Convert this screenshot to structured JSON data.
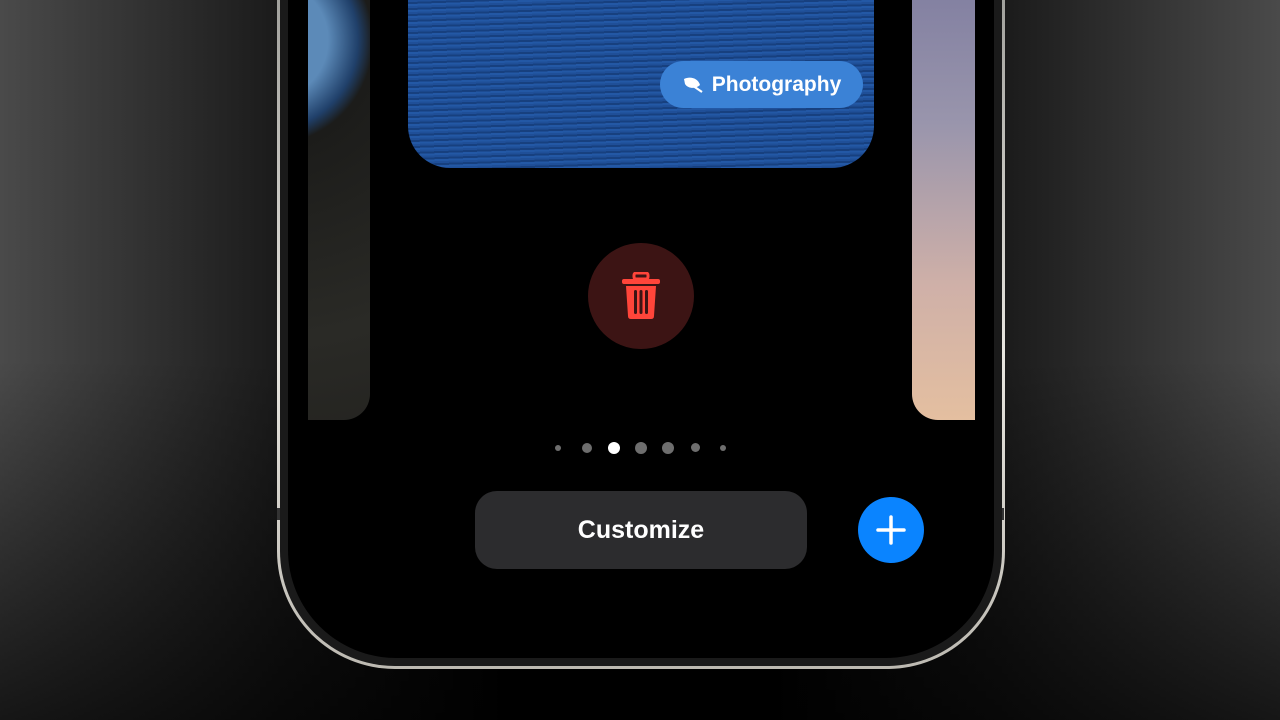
{
  "focus_label": {
    "text": "Photography",
    "icon": "leaf-icon"
  },
  "delete_button": {
    "icon": "trash-icon",
    "color": "#ff453a"
  },
  "page_indicator": {
    "count": 7,
    "active_index": 2
  },
  "customize_button": {
    "label": "Customize"
  },
  "add_button": {
    "icon": "plus-icon",
    "color": "#0a84ff"
  }
}
